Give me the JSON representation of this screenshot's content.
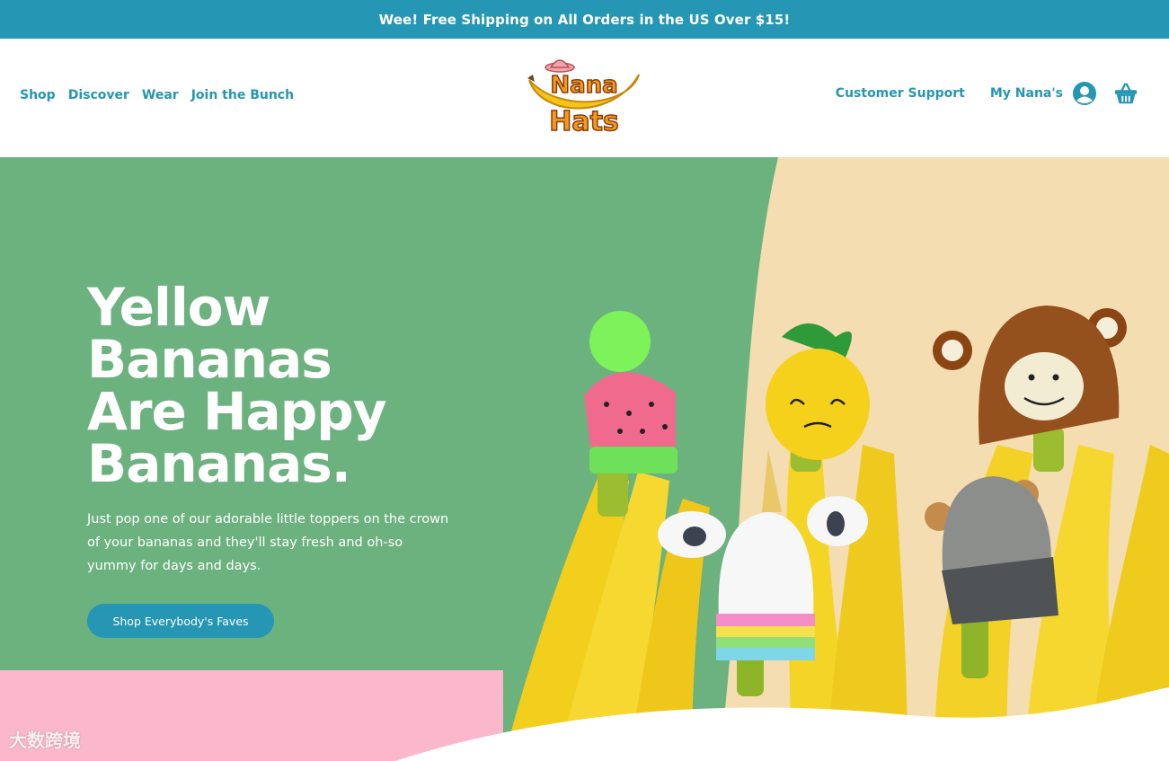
{
  "announcement": {
    "text": "Wee! Free Shipping on All Orders in the US Over $15!"
  },
  "nav_left": [
    {
      "label": "Shop"
    },
    {
      "label": "Discover"
    },
    {
      "label": "Wear"
    },
    {
      "label": "Join the Bunch"
    }
  ],
  "nav_right": {
    "support_label": "Customer Support",
    "account_label": "My Nana's",
    "account_icon": "user-circle-icon",
    "cart_icon": "basket-icon"
  },
  "logo": {
    "line1": "Nana",
    "line2": "Hats"
  },
  "hero": {
    "headline": [
      "Yellow",
      "Bananas",
      "Are Happy",
      "Bananas."
    ],
    "subcopy": "Just pop one of our adorable little toppers on the crown of your bananas and they'll stay fresh and oh-so yummy for days and days.",
    "cta_label": "Shop Everybody's Faves"
  },
  "watermark": {
    "text": "大数跨境"
  },
  "colors": {
    "brand_blue": "#2596b3",
    "hero_green": "#6cb27f",
    "hero_cream": "#f4ddb0",
    "hero_pink": "#fbb8cc",
    "banana_yellow": "#f5d21d"
  }
}
